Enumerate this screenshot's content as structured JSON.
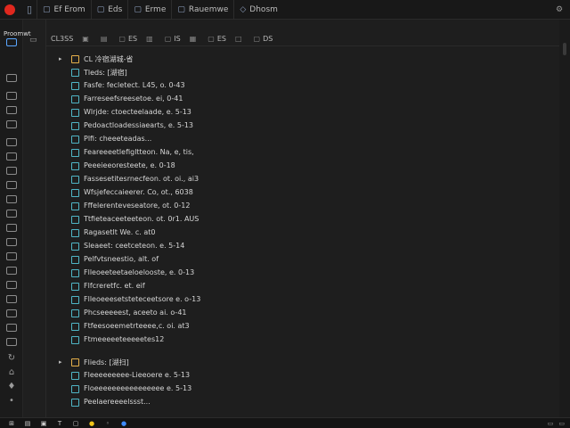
{
  "window": {
    "tabs": [
      {
        "label": "Ef Erom"
      },
      {
        "label": "Eds"
      },
      {
        "label": "Erme"
      },
      {
        "label": "Rauemwe"
      },
      {
        "label": "Dhosm"
      }
    ]
  },
  "toolbar": {
    "items": [
      {
        "label": "CL3SS"
      },
      {
        "label": ""
      },
      {
        "label": ""
      },
      {
        "label": "ES"
      },
      {
        "label": ""
      },
      {
        "label": "IS"
      },
      {
        "label": ""
      },
      {
        "label": "ES"
      },
      {
        "label": ""
      },
      {
        "label": "DS"
      }
    ]
  },
  "sidebar": {
    "caption": "Proomwt"
  },
  "tree": {
    "root_label": "CL 冷宿湖城-省",
    "group1": {
      "label": "Tleds: [湖宿]",
      "items": [
        "Fasfe: fecletect. L45, o. 0-43",
        "Farreseefsreesetoe. ei, 0-41",
        "Wlrjde: ctoecteelaade, e. 5-13",
        "Pedoactloadessiaearts, e. 5-13",
        "Plfi: cheeeteadas...",
        "Feareeeetlefigltteon. Na, e, tis,",
        "Peeeieeoresteete, e. 0-18",
        "Fassesetitesrnecfeon. ot. oi., ai3",
        "Wfsjefeccaieerer. Co, ot., 6038",
        "Fffelerenteveseatore, ot. 0-12",
        "Ttfieteaceeteeteon. ot. 0r1. AUS",
        "Ragasetlt We. c. at0",
        "Sleaeet: ceetceteon. e. 5-14",
        "Pelfvtsneestio, alt. of",
        "Flleoeeteetaeloelooste, e. 0-13",
        "Flfcreretfc. et. eif",
        "Flleoeeesetsteteceetsore e. o-13",
        "Phcseeeeest, aceeto ai. o-41",
        "Ftfeesoeemetrteeee,c. oi. at3",
        "Ftmeeeeeteeeeetes12"
      ]
    },
    "group2": {
      "label": "Flieds: [湖扫]",
      "items": [
        "Fleeeeeeeee-Lieeoere e. 5-13",
        "Floeeeeeeeeeeeeeeee e. 5-13",
        "Peelaereeeelssst..."
      ]
    }
  },
  "colors": {
    "accent": "#5aa6ff",
    "app_dot": "#e0281e",
    "file_icon": "#4fb6c6",
    "group_icon": "#e6b04a"
  }
}
